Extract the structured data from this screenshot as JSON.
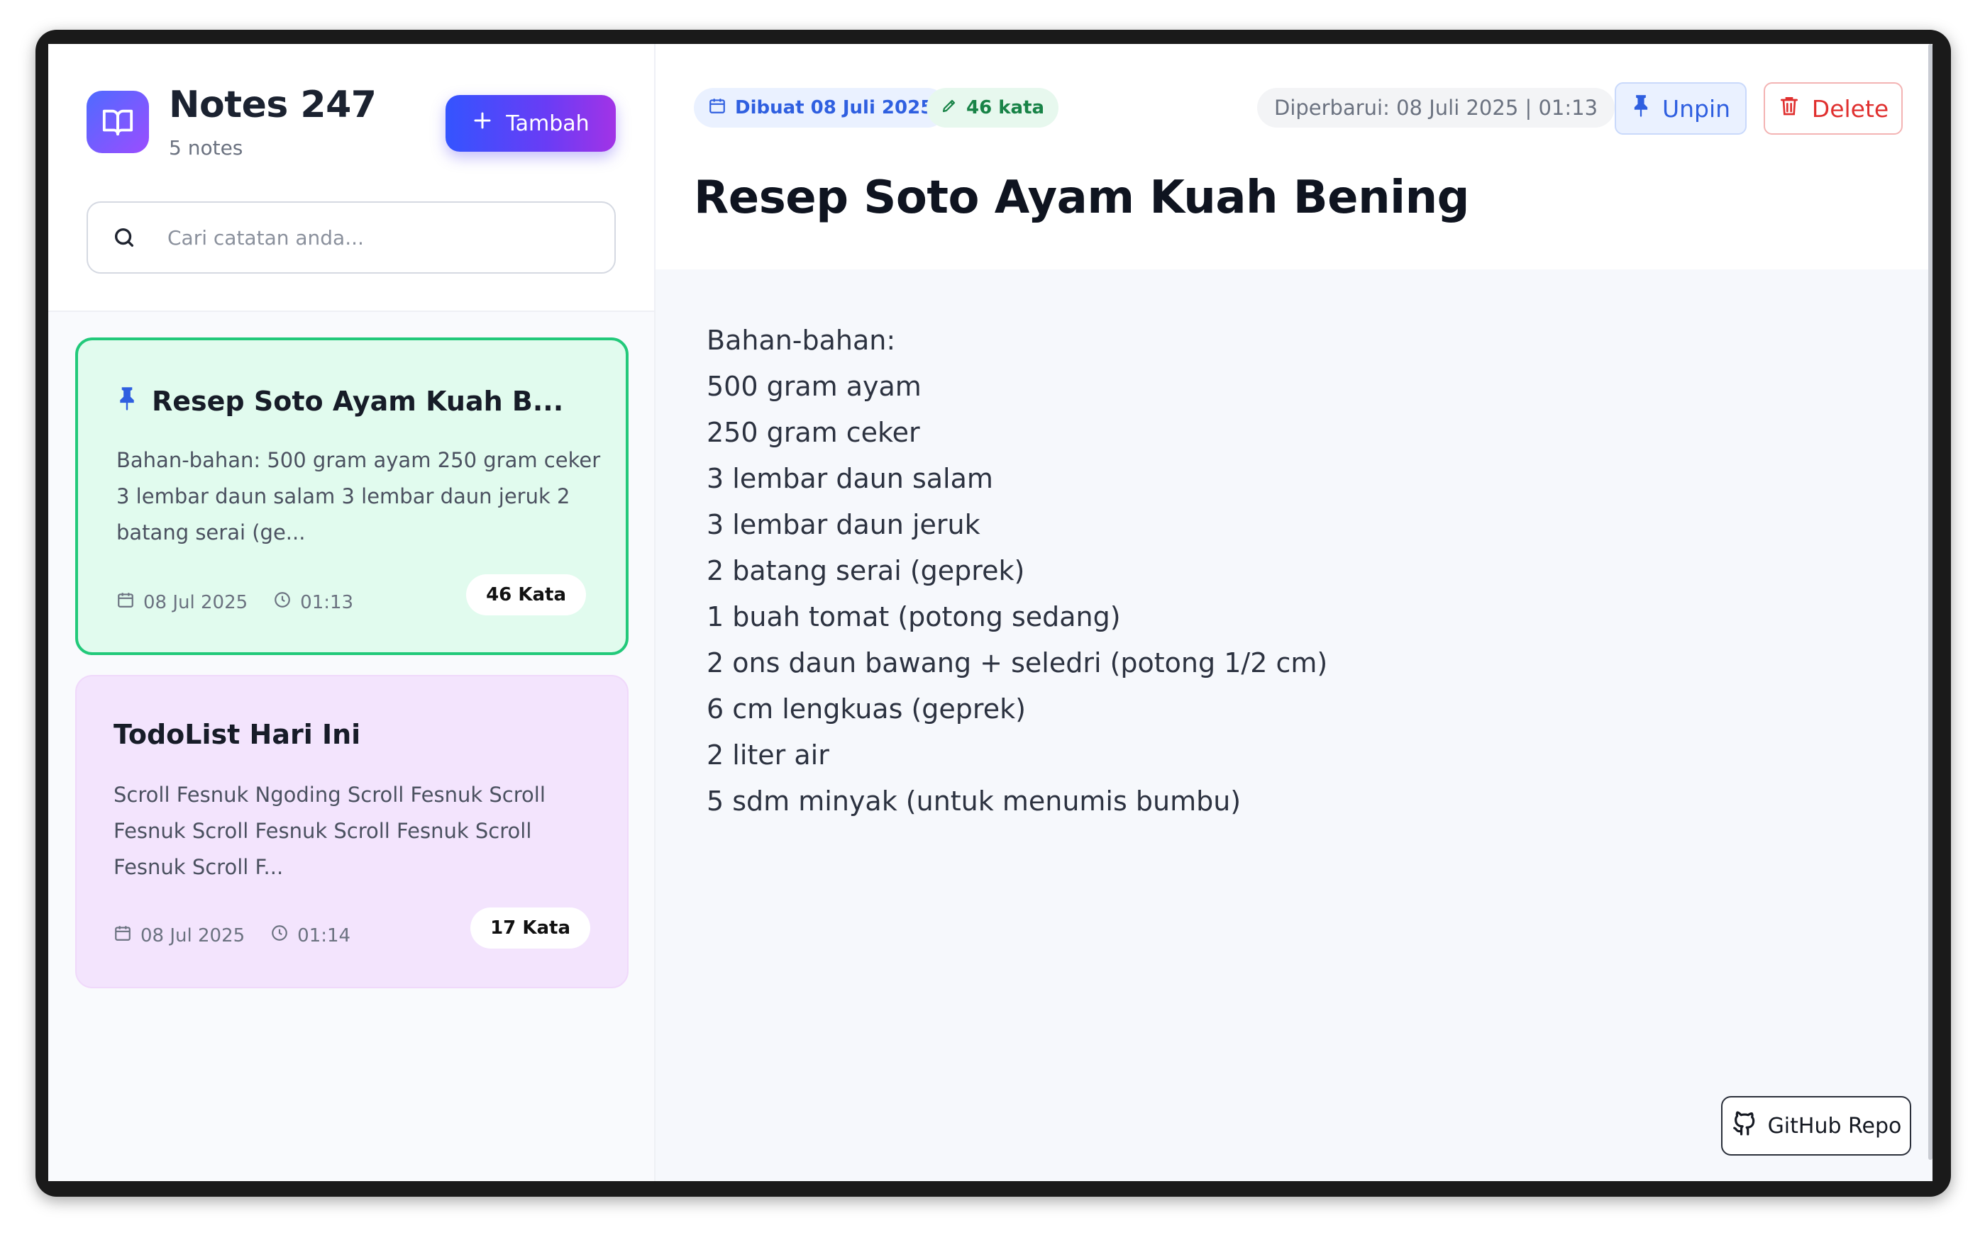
{
  "app": {
    "title": "Notes 247",
    "note_count": "5 notes",
    "add_button": "Tambah",
    "search_placeholder": "Cari catatan anda..."
  },
  "notes": [
    {
      "title": "Resep Soto Ayam Kuah B...",
      "preview": "Bahan-bahan: 500 gram ayam 250 gram ceker 3 lembar daun salam 3 lembar daun jeruk 2 batang serai (ge...",
      "date": "08 Jul 2025",
      "time": "01:13",
      "words": "46 Kata",
      "pinned": true,
      "color": "#e1fbee"
    },
    {
      "title": "TodoList Hari Ini",
      "preview": "Scroll Fesnuk Ngoding Scroll Fesnuk Scroll Fesnuk Scroll Fesnuk Scroll Fesnuk Scroll Fesnuk Scroll F...",
      "date": "08 Jul 2025",
      "time": "01:14",
      "words": "17 Kata",
      "pinned": false,
      "color": "#f3e4fd"
    }
  ],
  "detail": {
    "created": "Dibuat 08 Juli 2025",
    "word_count": "46 kata",
    "updated": "Diperbarui: 08 Juli 2025 | 01:13",
    "unpin_label": "Unpin",
    "delete_label": "Delete",
    "title": "Resep Soto Ayam Kuah Bening",
    "lines": [
      "Bahan-bahan:",
      "500 gram ayam",
      "250 gram ceker",
      "3 lembar daun salam",
      "3 lembar daun jeruk",
      "2 batang serai (geprek)",
      "1 buah tomat (potong sedang)",
      "2 ons daun bawang + seledri (potong 1/2 cm)",
      "6 cm lengkuas (geprek)",
      "2 liter air",
      "5 sdm minyak (untuk menumis bumbu)"
    ]
  },
  "footer": {
    "github_label": "GitHub Repo"
  },
  "colors": {
    "accent": "#3454ff",
    "active_border": "#22c97a",
    "danger": "#e0302f",
    "pin_blue": "#2f5fe0"
  },
  "icons": [
    "book-icon",
    "plus-icon",
    "search-icon",
    "pin-icon",
    "calendar-icon",
    "clock-icon",
    "pencil-icon",
    "trash-icon",
    "github-icon"
  ]
}
